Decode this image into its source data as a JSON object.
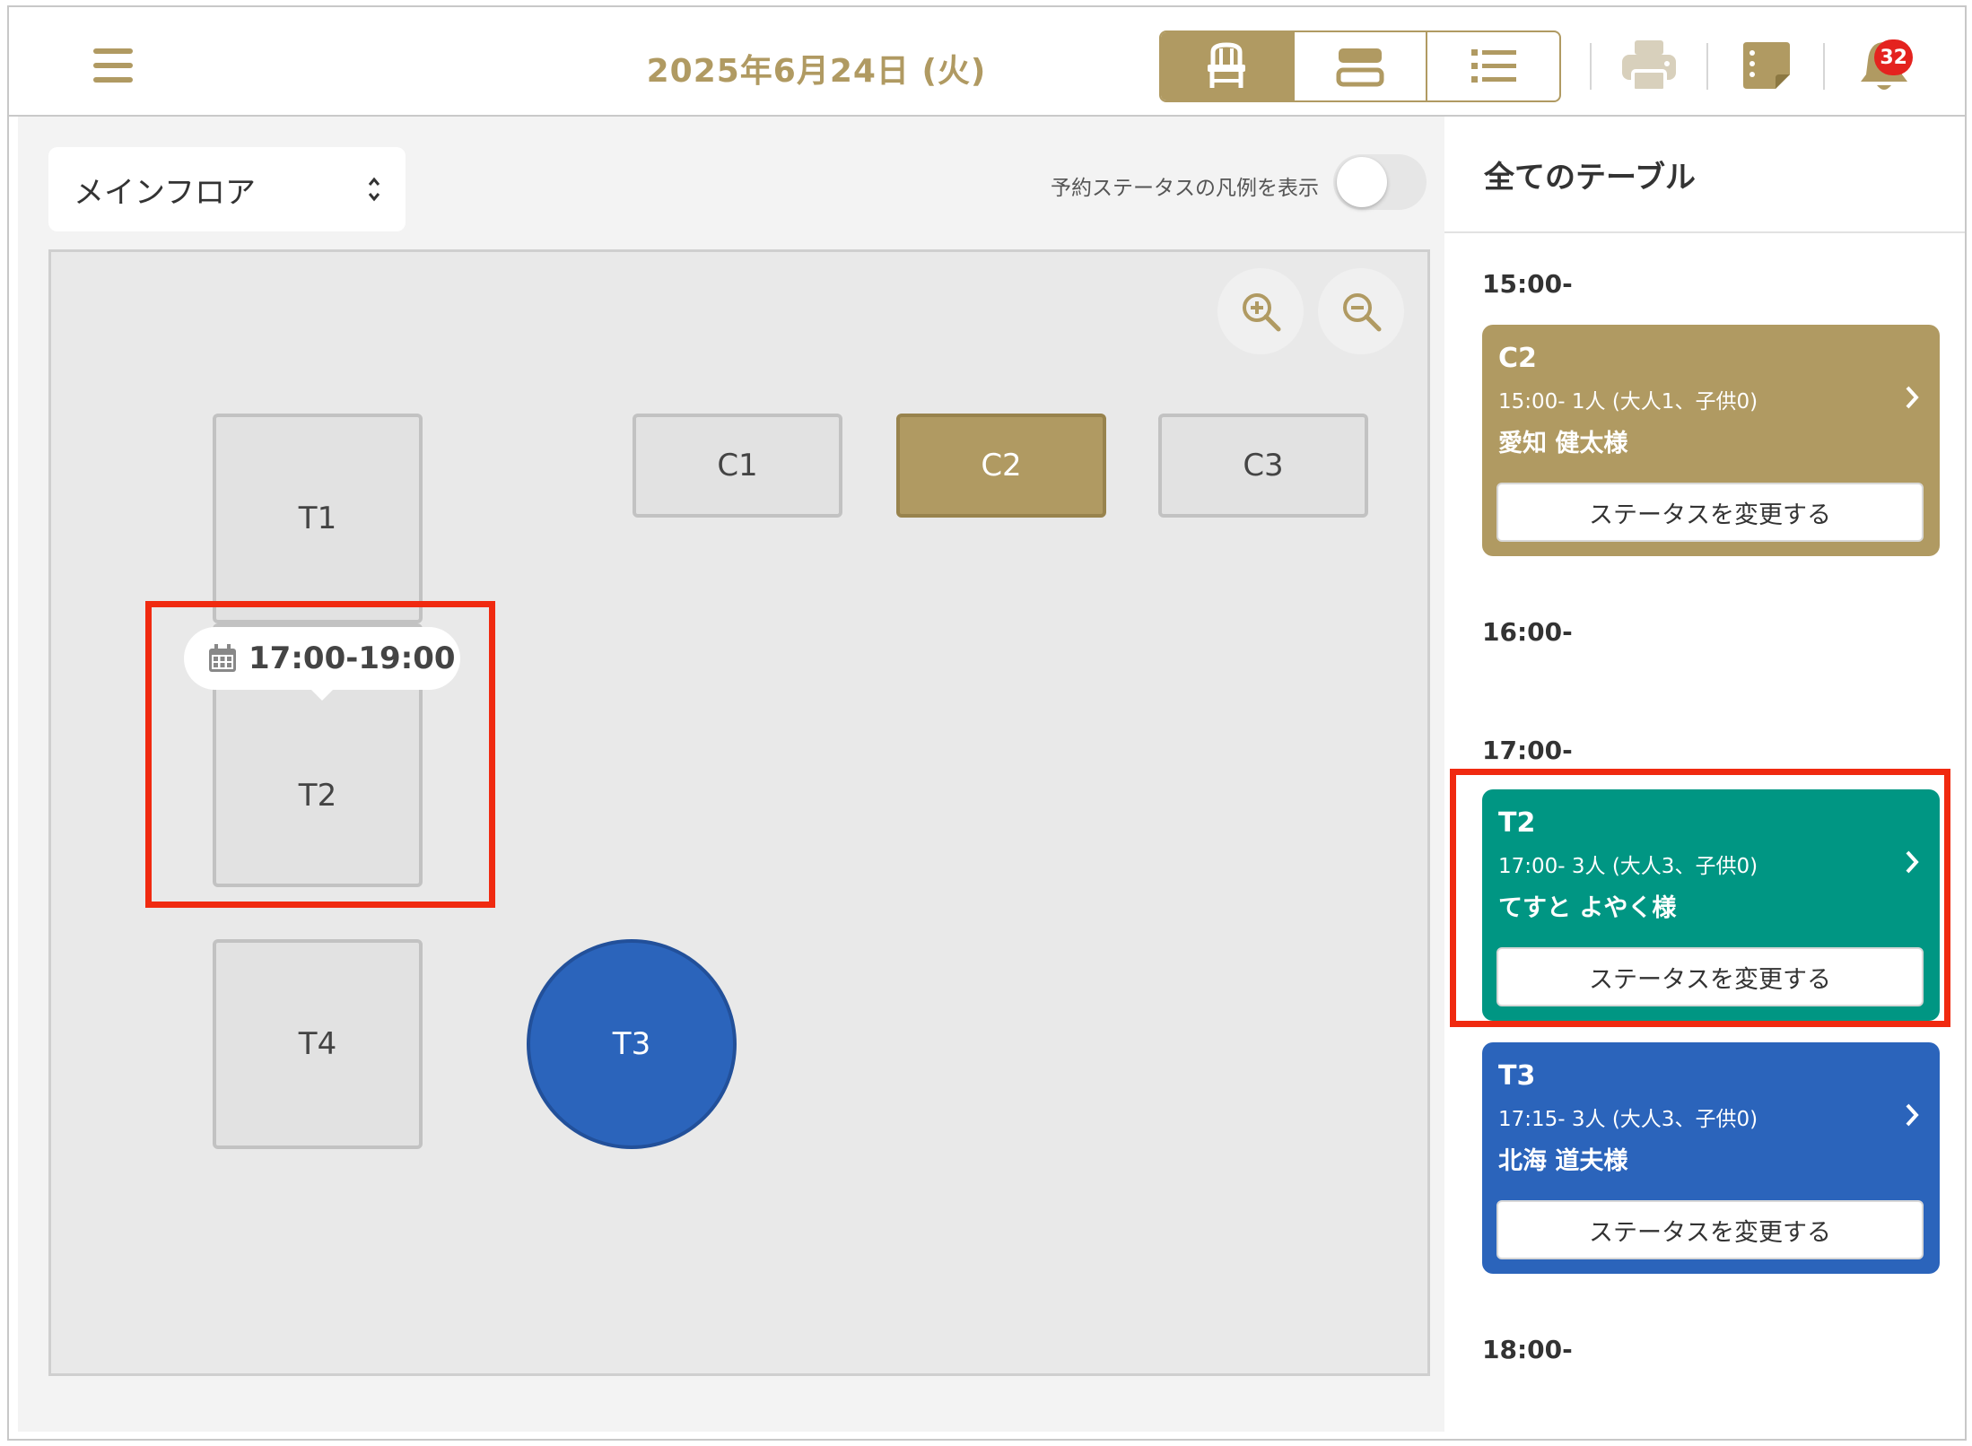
{
  "header": {
    "date": "2025年6月24日 (火)",
    "notification_count": "32",
    "colors": {
      "accent": "#b09a62",
      "badge": "#e4231f"
    }
  },
  "floor": {
    "selected_floor": "メインフロア",
    "legend_toggle_label": "予約ステータスの凡例を表示",
    "legend_toggle_on": false,
    "tables": {
      "t1": "T1",
      "t2": "T2",
      "t3": "T3",
      "t4": "T4",
      "c1": "C1",
      "c2": "C2",
      "c3": "C3"
    },
    "tooltip": "17:00-19:00"
  },
  "panel": {
    "title": "全てのテーブル",
    "slots": [
      "15:00-",
      "16:00-",
      "17:00-",
      "18:00-"
    ],
    "button_label": "ステータスを変更する",
    "cards": [
      {
        "table": "C2",
        "info": "15:00-  1人 (大人1、子供0)",
        "guest": "愛知 健太様",
        "color": "#b09a62"
      },
      {
        "table": "T2",
        "info": "17:00-  3人 (大人3、子供0)",
        "guest": "てすと よやく様",
        "color": "#009683"
      },
      {
        "table": "T3",
        "info": "17:15-  3人 (大人3、子供0)",
        "guest": "北海 道夫様",
        "color": "#2b64bb"
      }
    ]
  }
}
